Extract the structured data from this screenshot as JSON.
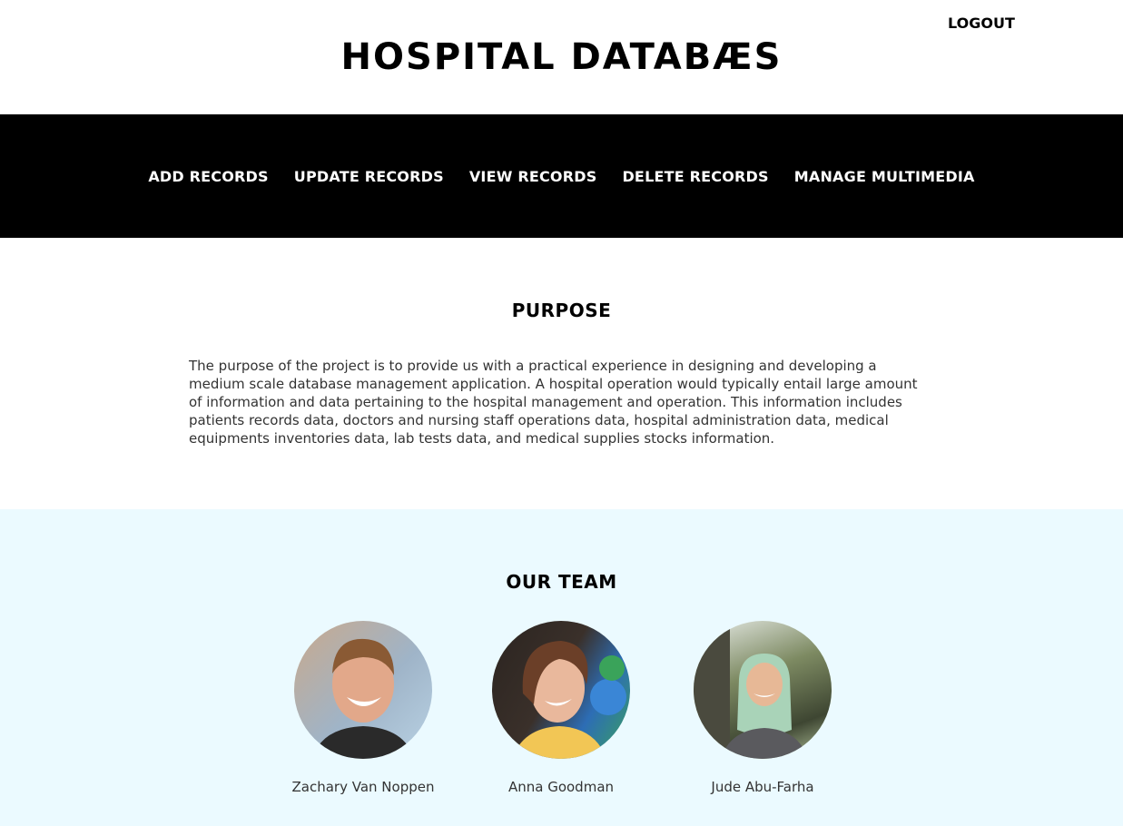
{
  "header": {
    "site_title": "HOSPITAL DATABÆS",
    "logout_label": "LOGOUT"
  },
  "nav": {
    "items": [
      {
        "label": "ADD RECORDS"
      },
      {
        "label": "UPDATE RECORDS"
      },
      {
        "label": "VIEW RECORDS"
      },
      {
        "label": "DELETE RECORDS"
      },
      {
        "label": "MANAGE MULTIMEDIA"
      }
    ]
  },
  "purpose": {
    "heading": "PURPOSE",
    "text": "The purpose of the project is to provide us with a practical experience in designing and developing a medium scale database management application. A hospital operation would typically entail large amount of information and data pertaining to the hospital management and operation. This information includes patients records data, doctors and nursing staff operations data, hospital administration data, medical equipments inventories data, lab tests data, and medical supplies stocks information."
  },
  "team": {
    "heading": "OUR TEAM",
    "members": [
      {
        "name": "Zachary Van Noppen"
      },
      {
        "name": "Anna Goodman"
      },
      {
        "name": "Jude Abu-Farha"
      }
    ]
  },
  "colors": {
    "navbar_bg": "#000000",
    "team_bg": "#ebfaff",
    "text": "#333333"
  }
}
